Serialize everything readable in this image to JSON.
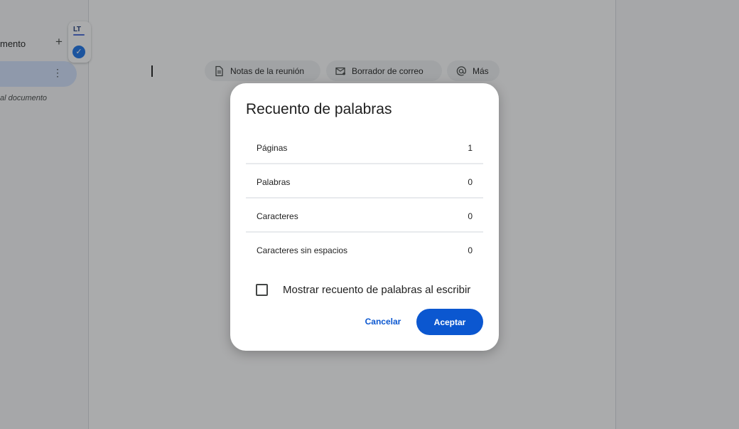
{
  "sidebar": {
    "tabs_label": "mento",
    "add_symbol": "+",
    "tab_menu_symbol": "⋮",
    "subtitle": "al documento"
  },
  "extension": {
    "logo_text": "LT",
    "check_symbol": "✓",
    "accent": "#1a73e8"
  },
  "chips": [
    {
      "label": "Notas de la reunión",
      "icon": "document-icon"
    },
    {
      "label": "Borrador de correo",
      "icon": "email-draft-icon"
    },
    {
      "label": "Más",
      "icon": "at-sign-icon"
    }
  ],
  "dialog": {
    "title": "Recuento de palabras",
    "rows": [
      {
        "label": "Páginas",
        "value": "1"
      },
      {
        "label": "Palabras",
        "value": "0"
      },
      {
        "label": "Caracteres",
        "value": "0"
      },
      {
        "label": "Caracteres sin espacios",
        "value": "0"
      }
    ],
    "checkbox_label": "Mostrar recuento de palabras al escribir",
    "checkbox_checked": false,
    "cancel_label": "Cancelar",
    "accept_label": "Aceptar",
    "accent": "#0b57d0"
  }
}
